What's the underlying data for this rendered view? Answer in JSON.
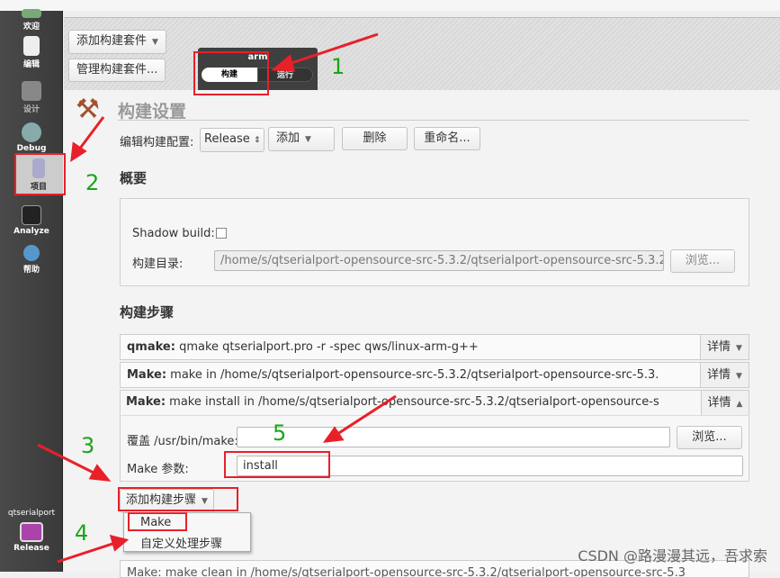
{
  "sidebar": {
    "items": [
      {
        "label": "欢迎",
        "icon": "welcome-icon"
      },
      {
        "label": "编辑",
        "icon": "edit-icon"
      },
      {
        "label": "设计",
        "icon": "design-icon"
      },
      {
        "label": "Debug",
        "icon": "debug-icon"
      },
      {
        "label": "项目",
        "icon": "project-icon"
      },
      {
        "label": "Analyze",
        "icon": "analyze-icon"
      },
      {
        "label": "帮助",
        "icon": "help-icon"
      }
    ],
    "project": "qtserialport",
    "build_config": "Release"
  },
  "header": {
    "add_kit": "添加构建套件",
    "manage_kits": "管理构建套件...",
    "kit_name": "arm",
    "kit_build": "构建",
    "kit_run": "运行"
  },
  "build_settings": {
    "title": "构建设置",
    "edit_config_label": "编辑构建配置:",
    "config_value": "Release",
    "add": "添加",
    "delete": "删除",
    "rename": "重命名..."
  },
  "overview": {
    "title": "概要",
    "shadow_build_label": "Shadow build:",
    "shadow_build_checked": false,
    "build_dir_label": "构建目录:",
    "build_dir": "/home/s/qtserialport-opensource-src-5.3.2/qtserialport-opensource-src-5.3.2",
    "browse": "浏览..."
  },
  "build_steps": {
    "title": "构建步骤",
    "details": "详情",
    "steps": [
      {
        "name": "qmake:",
        "cmd": "qmake qtserialport.pro -r -spec qws/linux-arm-g++"
      },
      {
        "name": "Make:",
        "cmd": "make in /home/s/qtserialport-opensource-src-5.3.2/qtserialport-opensource-src-5.3."
      },
      {
        "name": "Make:",
        "cmd": "make install in /home/s/qtserialport-opensource-src-5.3.2/qtserialport-opensource-s"
      }
    ],
    "override_label": "覆盖 /usr/bin/make:",
    "override_value": "",
    "browse": "浏览...",
    "make_args_label": "Make 参数:",
    "make_args": "install",
    "add_step": "添加构建步骤",
    "menu": [
      "Make",
      "自定义处理步骤"
    ],
    "clean_step": "Make: make clean in /home/s/qtserialport-opensource-src-5.3.2/qtserialport-opensource-src-5.3"
  },
  "annotations": [
    "1",
    "2",
    "3",
    "4",
    "5"
  ],
  "watermark": "CSDN @路漫漫其远，吾求索",
  "colors": {
    "annotation_red": "#e8202a",
    "annotation_green": "#1aa51a"
  }
}
